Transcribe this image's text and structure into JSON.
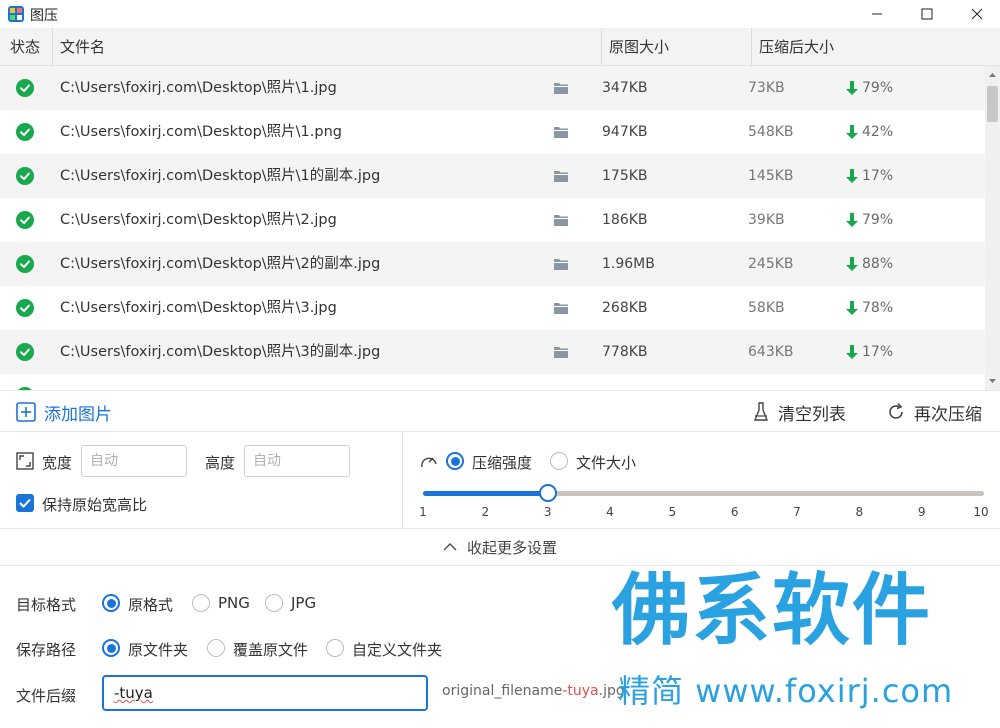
{
  "window": {
    "title": "图压"
  },
  "table": {
    "headers": {
      "status": "状态",
      "filename": "文件名",
      "original_size": "原图大小",
      "compressed_size": "压缩后大小"
    },
    "rows": [
      {
        "path": "C:\\Users\\foxirj.com\\Desktop\\照片\\1.jpg",
        "orig": "347KB",
        "comp": "73KB",
        "pct": "79%"
      },
      {
        "path": "C:\\Users\\foxirj.com\\Desktop\\照片\\1.png",
        "orig": "947KB",
        "comp": "548KB",
        "pct": "42%"
      },
      {
        "path": "C:\\Users\\foxirj.com\\Desktop\\照片\\1的副本.jpg",
        "orig": "175KB",
        "comp": "145KB",
        "pct": "17%"
      },
      {
        "path": "C:\\Users\\foxirj.com\\Desktop\\照片\\2.jpg",
        "orig": "186KB",
        "comp": "39KB",
        "pct": "79%"
      },
      {
        "path": "C:\\Users\\foxirj.com\\Desktop\\照片\\2的副本.jpg",
        "orig": "1.96MB",
        "comp": "245KB",
        "pct": "88%"
      },
      {
        "path": "C:\\Users\\foxirj.com\\Desktop\\照片\\3.jpg",
        "orig": "268KB",
        "comp": "58KB",
        "pct": "78%"
      },
      {
        "path": "C:\\Users\\foxirj.com\\Desktop\\照片\\3的副本.jpg",
        "orig": "778KB",
        "comp": "643KB",
        "pct": "17%"
      }
    ]
  },
  "toolbar": {
    "add": "添加图片",
    "clear": "清空列表",
    "recompress": "再次压缩"
  },
  "resize": {
    "width_label": "宽度",
    "width_placeholder": "自动",
    "height_label": "高度",
    "height_placeholder": "自动",
    "keep_ratio": "保持原始宽高比"
  },
  "compress": {
    "mode_strength": "压缩强度",
    "mode_filesize": "文件大小",
    "ticks": [
      "1",
      "2",
      "3",
      "4",
      "5",
      "6",
      "7",
      "8",
      "9",
      "10"
    ],
    "level": 3
  },
  "collapse_label": "收起更多设置",
  "output": {
    "format_label": "目标格式",
    "format_options": [
      "原格式",
      "PNG",
      "JPG"
    ],
    "path_label": "保存路径",
    "path_options": [
      "原文件夹",
      "覆盖原文件",
      "自定义文件夹"
    ],
    "suffix_label": "文件后缀",
    "suffix_value": "-tuya",
    "example_prefix": "original_filename",
    "example_suffix": "-tuya",
    "example_ext": ".jpg"
  },
  "watermark": {
    "big": "佛系软件",
    "small": "精简 www.foxirj.com"
  },
  "colors": {
    "accent": "#1a73d9",
    "success": "#1aa84e",
    "watermark": "#2aa1e0"
  }
}
